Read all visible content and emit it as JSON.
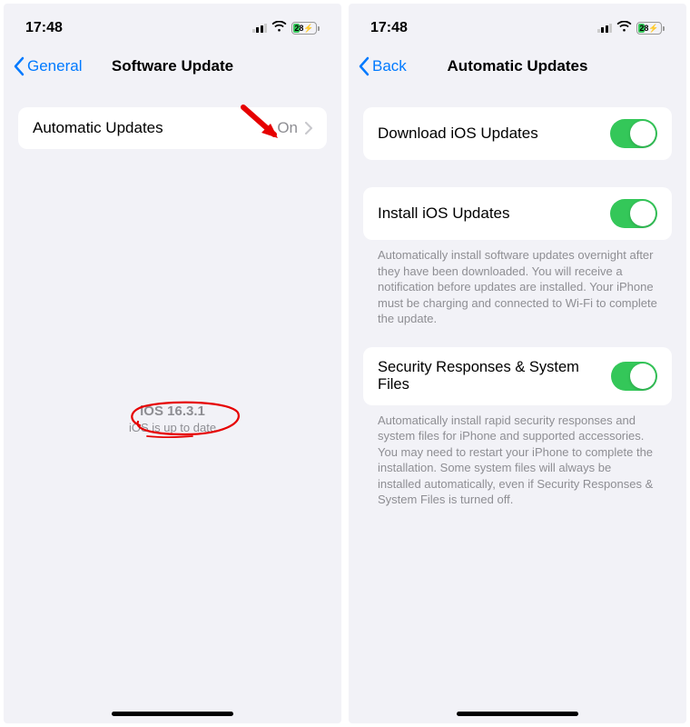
{
  "statusbar": {
    "time": "17:48",
    "battery_percent": "28",
    "battery_has_bolt": true
  },
  "left": {
    "back_label": "General",
    "title": "Software Update",
    "auto_updates": {
      "label": "Automatic Updates",
      "value": "On"
    },
    "status": {
      "version": "iOS 16.3.1",
      "message": "iOS is up to date"
    }
  },
  "right": {
    "back_label": "Back",
    "title": "Automatic Updates",
    "rows": {
      "download": {
        "label": "Download iOS Updates",
        "on": true
      },
      "install": {
        "label": "Install iOS Updates",
        "on": true
      },
      "install_footer": "Automatically install software updates overnight after they have been downloaded. You will receive a notification before updates are installed. Your iPhone must be charging and connected to Wi-Fi to complete the update.",
      "security": {
        "label": "Security Responses & System Files",
        "on": true
      },
      "security_footer": "Automatically install rapid security responses and system files for iPhone and supported accessories. You may need to restart your iPhone to complete the installation. Some system files will always be installed automatically, even if Security Responses & System Files is turned off."
    }
  },
  "colors": {
    "accent": "#007aff",
    "toggle_on": "#34c759",
    "annotation": "#e60000"
  }
}
